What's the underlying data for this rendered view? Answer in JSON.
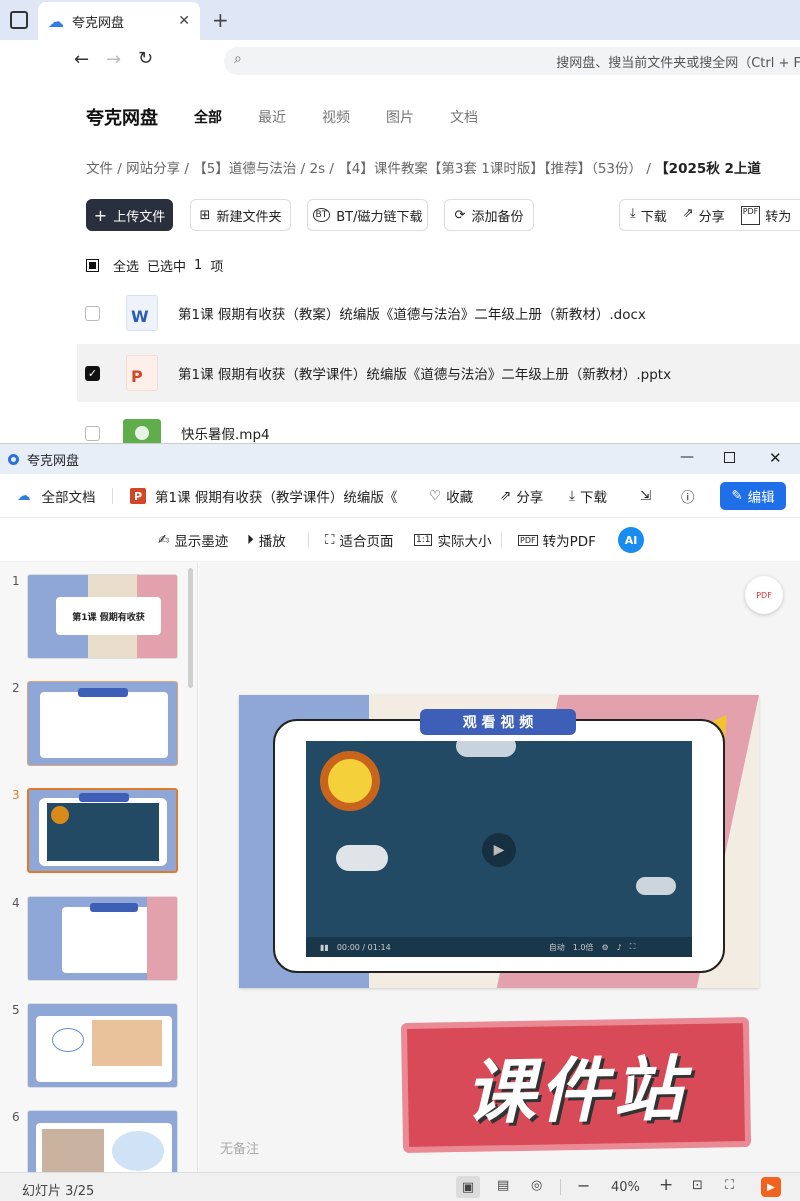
{
  "browser": {
    "tab_title": "夸克网盘",
    "address_placeholder": "搜网盘、搜当前文件夹或搜全网（Ctrl + F）"
  },
  "drive": {
    "brand": "夸克网盘",
    "nav_tabs": [
      "全部",
      "最近",
      "视频",
      "图片",
      "文档"
    ],
    "breadcrumb": [
      "文件",
      "网站分享",
      "【5】道德与法治",
      "2s",
      "【4】课件教案【第3套 1课时版】【推荐】（53份）",
      "【2025秋 2上道"
    ],
    "actions": {
      "upload": "上传文件",
      "new_folder": "新建文件夹",
      "bt": "BT/磁力链下载",
      "backup": "添加备份",
      "download": "下载",
      "share": "分享",
      "convert": "转为"
    },
    "select_all": "全选",
    "selected_text": "已选中",
    "selected_count": "1",
    "selected_unit": "项",
    "files": [
      {
        "name": "第1课 假期有收获（教案）统编版《道德与法治》二年级上册（新教材）.docx",
        "type": "word",
        "checked": false
      },
      {
        "name": "第1课 假期有收获（教学课件）统编版《道德与法治》二年级上册（新教材）.pptx",
        "type": "ppt",
        "checked": true
      },
      {
        "name": "快乐暑假.mp4",
        "type": "video",
        "checked": false
      }
    ]
  },
  "viewer": {
    "window_title": "夸克网盘",
    "all_docs": "全部文档",
    "doc_title": "第1课 假期有收获（教学课件）统编版《",
    "collect": "收藏",
    "share": "分享",
    "download": "下载",
    "edit": "编辑",
    "tools": {
      "ink": "显示墨迹",
      "play": "播放",
      "fit": "适合页面",
      "actual": "实际大小",
      "pdf": "转为PDF"
    },
    "slides": [
      "1",
      "2",
      "3",
      "4",
      "5",
      "6"
    ],
    "current_slide": 3,
    "slide1_title": "第1课 假期有收获",
    "slide3_title": "观 看 视 频",
    "video_time": "00:00 / 01:14",
    "video_auto": "自动",
    "video_speed": "1.0倍",
    "watermark": "课件站",
    "notes": "无备注",
    "status": "幻灯片 3/25",
    "zoom": "40%"
  }
}
